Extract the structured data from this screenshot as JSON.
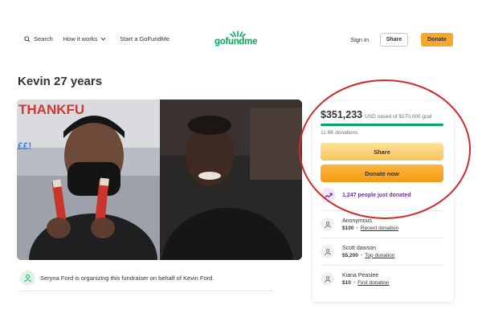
{
  "header": {
    "search_label": "Search",
    "how_it_works_label": "How it works",
    "start_label": "Start a GoFundMe",
    "logo_text": "gofundme",
    "signin_label": "Sign in",
    "share_label": "Share",
    "donate_label": "Donate",
    "brand_color": "#02a95c",
    "accent_color": "#f4a82c"
  },
  "campaign": {
    "title": "Kevin 27 years",
    "hero_text": "THANKFU",
    "organizer_text": "Seryna Ford is organizing this fundraiser on behalf of Kevin Ford."
  },
  "sidebar": {
    "raised_amount": "$351,233",
    "raised_rest": "USD raised of $270,000 goal",
    "progress_fraction": 1.0,
    "donations_count": "11.6K donations",
    "share_button": "Share",
    "donate_button": "Donate now",
    "trend_text": "1,247 people just donated",
    "trend_color": "#6c2da7",
    "donors": [
      {
        "name": "Anonymous",
        "amount": "$100",
        "tag": "Recent donation"
      },
      {
        "name": "Scott dawson",
        "amount": "$5,200",
        "tag": "Top donation"
      },
      {
        "name": "Kiana Peaslee",
        "amount": "$10",
        "tag": "First donation"
      }
    ]
  },
  "annotation": {
    "circle_color": "#cf2b2b"
  }
}
